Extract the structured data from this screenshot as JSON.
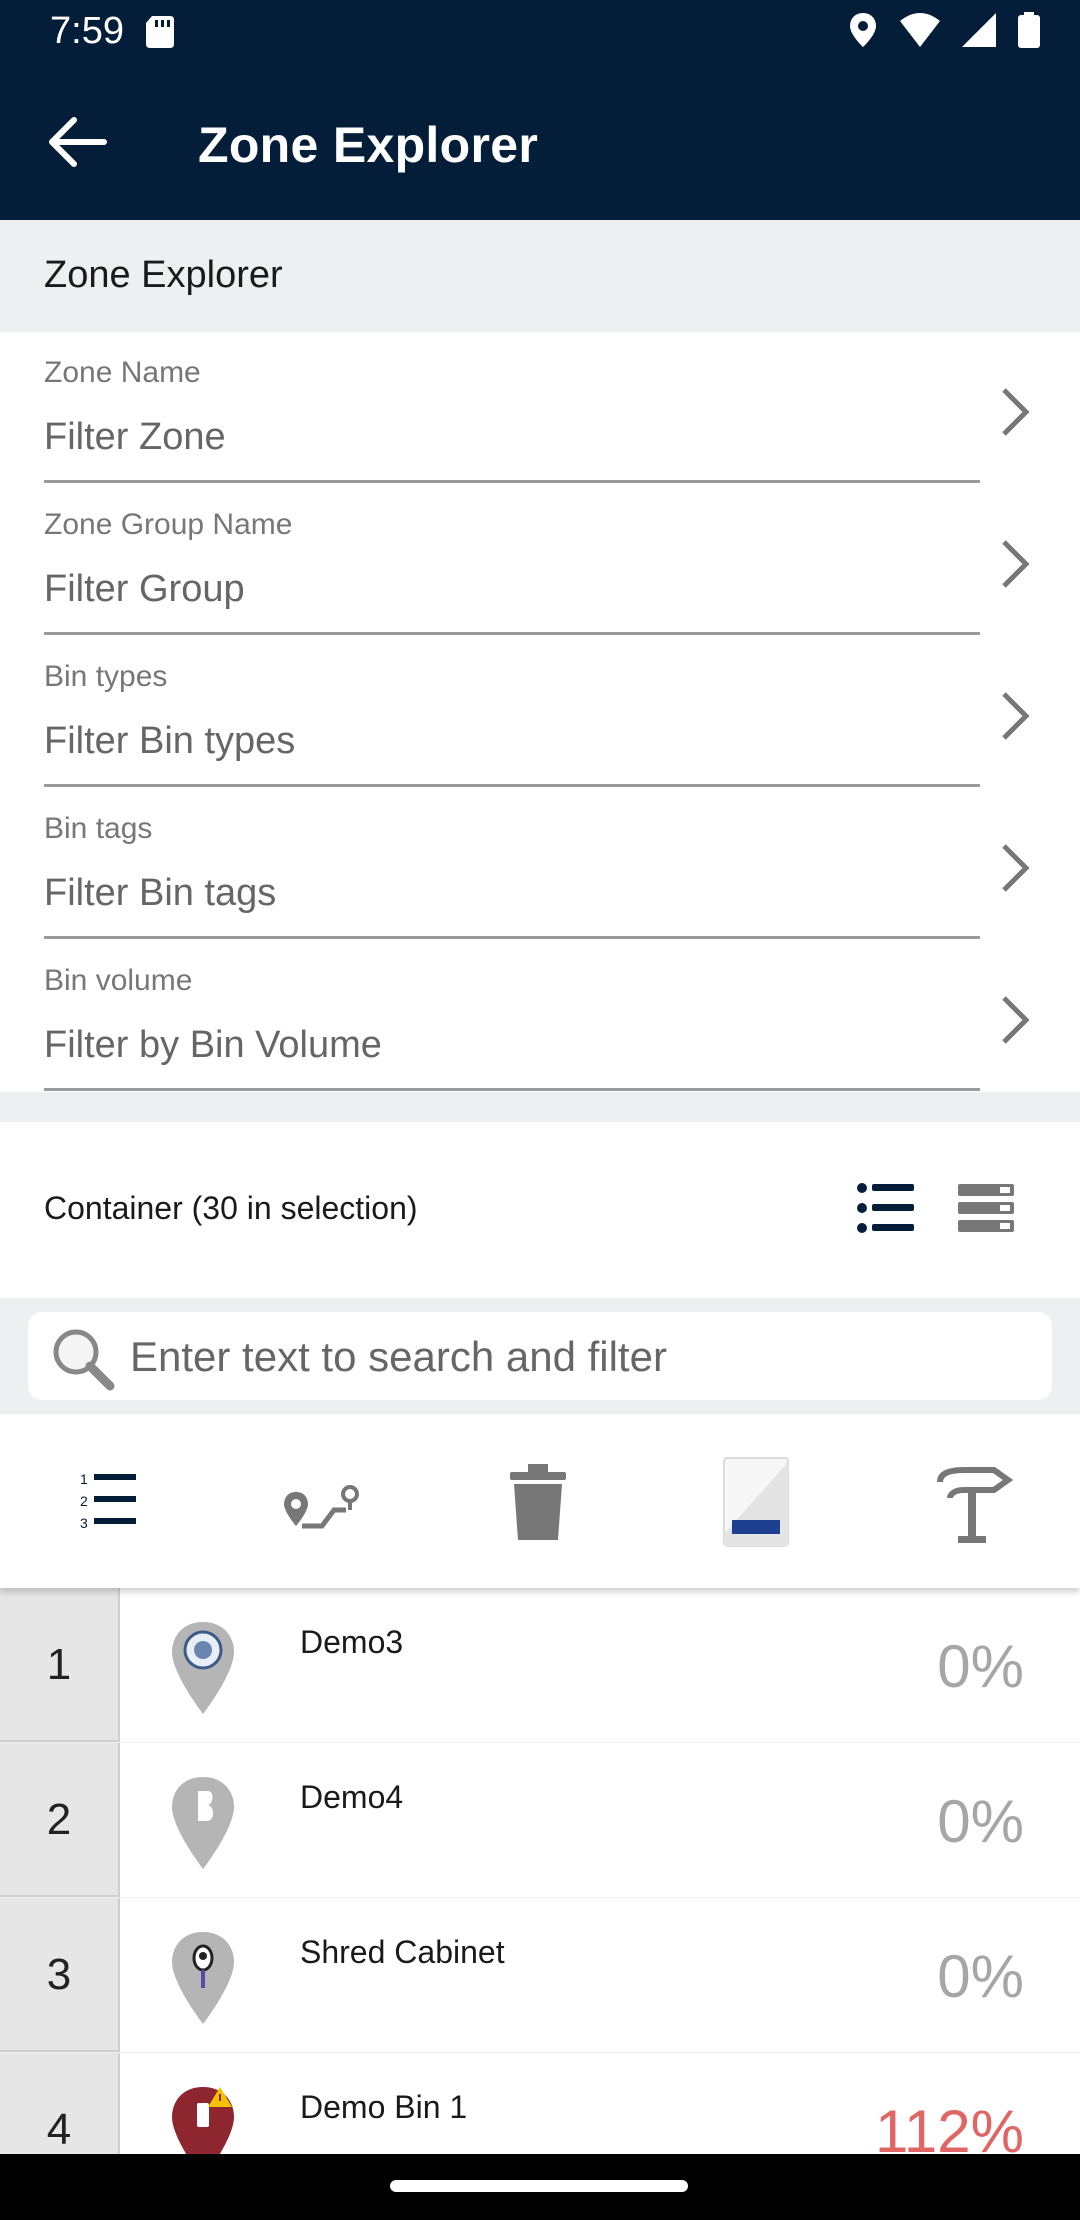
{
  "status_bar": {
    "time": "7:59",
    "icons": [
      "sd-card-icon",
      "location-icon",
      "wifi-icon",
      "signal-icon",
      "battery-icon"
    ]
  },
  "app_bar": {
    "title": "Zone Explorer",
    "back_icon": "arrow-left-icon"
  },
  "section": {
    "title": "Zone Explorer"
  },
  "filters": [
    {
      "label": "Zone Name",
      "value": "Filter Zone"
    },
    {
      "label": "Zone Group Name",
      "value": "Filter Group"
    },
    {
      "label": "Bin types",
      "value": "Filter Bin types"
    },
    {
      "label": "Bin tags",
      "value": "Filter Bin tags"
    },
    {
      "label": "Bin volume",
      "value": "Filter by Bin Volume"
    }
  ],
  "container": {
    "title": "Container (30 in selection)",
    "view_modes": [
      "list-view-icon",
      "compact-view-icon"
    ]
  },
  "search": {
    "placeholder": "Enter text to search and filter"
  },
  "toolbar": {
    "items": [
      "numbered-list-icon",
      "route-icon",
      "trash-icon",
      "fill-level-icon",
      "signpost-icon"
    ],
    "accent_color": "#1f3f91"
  },
  "bins": [
    {
      "index": "1",
      "name": "Demo3",
      "percent": "0%"
    },
    {
      "index": "2",
      "name": "Demo4",
      "percent": "0%"
    },
    {
      "index": "3",
      "name": "Shred Cabinet",
      "percent": "0%"
    },
    {
      "index": "4",
      "name": "Demo Bin 1",
      "percent": "112%",
      "warning": true
    }
  ],
  "colors": {
    "app_bar": "#041e3a",
    "over_capacity": "#e06666",
    "normal_percent": "#a6a6a6"
  }
}
